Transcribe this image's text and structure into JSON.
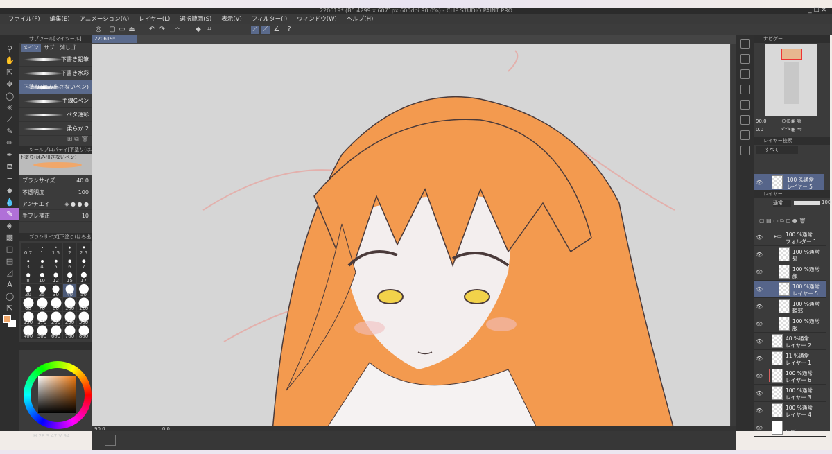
{
  "window": {
    "title": "220619* (B5 4299 x 6071px 600dpi 90.0%)  - CLIP STUDIO PAINT PRO",
    "controls": "_ ☐ ✕"
  },
  "menu": [
    "ファイル(F)",
    "編集(E)",
    "アニメーション(A)",
    "レイヤー(L)",
    "選択範囲(S)",
    "表示(V)",
    "フィルター(I)",
    "ウィンドウ(W)",
    "ヘルプ(H)"
  ],
  "document_tab": "220619*",
  "subtool": {
    "header": "サブツール[マイツール]",
    "tabs": [
      "メイン",
      "サブ",
      "消しゴ"
    ],
    "brushes": [
      {
        "name": "下書き鉛筆"
      },
      {
        "name": "下書き水彩"
      },
      {
        "name": "下塗り(はみ出さないペン)",
        "selected": true
      },
      {
        "name": "主線Gペン"
      },
      {
        "name": "ベタ油彩"
      },
      {
        "name": "柔らか 2"
      }
    ]
  },
  "tool_property": {
    "header": "ツールプロパティ[下塗り(はみ出…",
    "preview_name": "下塗り(はみ出さないペン)",
    "brush_size_label": "ブラシサイズ",
    "brush_size": "40.0",
    "opacity_label": "不透明度",
    "opacity": "100",
    "antialias_label": "アンチエイ",
    "stabilization_label": "手ブレ補正",
    "stabilization": "10"
  },
  "brush_size_panel": {
    "header": "ブラシサイズ[下塗り(はみ出さ…",
    "sizes": [
      "0.7",
      "1",
      "1.5",
      "2",
      "2.5",
      "3",
      "4",
      "5",
      "6",
      "7",
      "8",
      "10",
      "12",
      "15",
      "17",
      "20",
      "25",
      "30",
      "40",
      "50",
      "60",
      "70",
      "80",
      "100",
      "120",
      "150",
      "170",
      "200",
      "250",
      "300",
      "400",
      "500",
      "600",
      "700",
      "800"
    ],
    "selected": "40"
  },
  "color": {
    "main": "#f0a76a",
    "sub": "#ffffff",
    "hue_color": "#f07a10",
    "values": [
      "28",
      "47",
      "94"
    ]
  },
  "canvas_status": {
    "zoom": "90.0",
    "angle": "0.0"
  },
  "navigator": {
    "tab": "ナビゲー",
    "zoom": "90.0",
    "angle": "0.0"
  },
  "layer_search": {
    "tab": "レイヤー検索",
    "filter": "すべて",
    "result": {
      "mode": "100 %通常",
      "name": "レイヤー 5"
    }
  },
  "layer_panel": {
    "tab": "レイヤー",
    "blend": "通常",
    "opacity": "100",
    "layers": [
      {
        "mode": "100 %通常",
        "name": "フォルダー 1",
        "folder": true,
        "indent": 0
      },
      {
        "mode": "100 %通常",
        "name": "髪",
        "indent": 1
      },
      {
        "mode": "100 %通常",
        "name": "顔",
        "indent": 1
      },
      {
        "mode": "100 %通常",
        "name": "レイヤー 5",
        "indent": 1,
        "selected": true
      },
      {
        "mode": "100 %通常",
        "name": "輪郭",
        "indent": 1
      },
      {
        "mode": "100 %通常",
        "name": "服",
        "indent": 1
      },
      {
        "mode": "40 %通常",
        "name": "レイヤー 2",
        "indent": 0
      },
      {
        "mode": "11 %通常",
        "name": "レイヤー 1",
        "indent": 0
      },
      {
        "mode": "100 %通常",
        "name": "レイヤー 6",
        "indent": 0,
        "color_tag": "#d9605f"
      },
      {
        "mode": "100 %通常",
        "name": "レイヤー 3",
        "indent": 0
      },
      {
        "mode": "100 %通常",
        "name": "レイヤー 4",
        "indent": 0
      },
      {
        "mode": "",
        "name": "用紙",
        "indent": 0,
        "paper": true
      }
    ]
  },
  "illustration": {
    "hair": "#f39a4f",
    "line": "#4a3a3a",
    "skin": "#f3eeee",
    "eye": "#f2d24a",
    "background": "#d6d6d6"
  }
}
